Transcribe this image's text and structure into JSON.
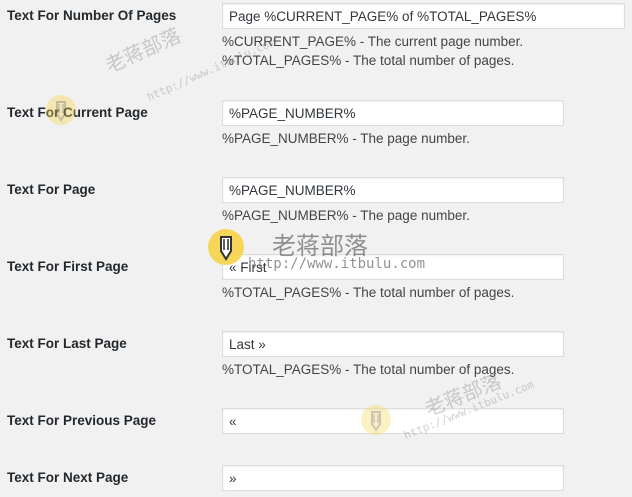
{
  "rows": [
    {
      "label": "Text For Number Of Pages",
      "value": "Page %CURRENT_PAGE% of %TOTAL_PAGES%",
      "description_1": "%CURRENT_PAGE% - The current page number.",
      "description_2": "%TOTAL_PAGES% - The total number of pages."
    },
    {
      "label": "Text For Current Page",
      "value": "%PAGE_NUMBER%",
      "description_1": "%PAGE_NUMBER% - The page number."
    },
    {
      "label": "Text For Page",
      "value": "%PAGE_NUMBER%",
      "description_1": "%PAGE_NUMBER% - The page number."
    },
    {
      "label": "Text For First Page",
      "value": "« First",
      "description_1": "%TOTAL_PAGES% - The total number of pages."
    },
    {
      "label": "Text For Last Page",
      "value": "Last »",
      "description_1": "%TOTAL_PAGES% - The total number of pages."
    },
    {
      "label": "Text For Previous Page",
      "value": "«"
    },
    {
      "label": "Text For Next Page",
      "value": "»"
    }
  ],
  "watermark": {
    "site_name": "老蒋部落",
    "url": "http://www.itbulu.com",
    "url_spaced": "http://www.itbulu.com",
    "icon": "pencil-badge-icon",
    "badge_color": "#f6d348"
  }
}
